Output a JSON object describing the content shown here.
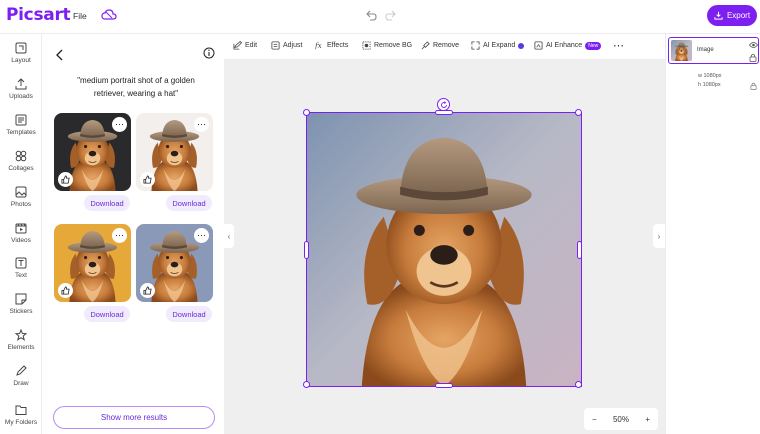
{
  "app": {
    "logo_text": "Picsart",
    "brand_color": "#7e1ff2",
    "file_menu": "File",
    "export_label": "Export"
  },
  "rail": {
    "items": [
      {
        "label": "Layout",
        "icon": "layout-icon"
      },
      {
        "label": "Uploads",
        "icon": "upload-icon"
      },
      {
        "label": "Templates",
        "icon": "templates-icon"
      },
      {
        "label": "Collages",
        "icon": "collages-icon"
      },
      {
        "label": "Photos",
        "icon": "photos-icon"
      },
      {
        "label": "Videos",
        "icon": "videos-icon"
      },
      {
        "label": "Text",
        "icon": "text-icon"
      },
      {
        "label": "Stickers",
        "icon": "stickers-icon"
      },
      {
        "label": "Elements",
        "icon": "elements-icon"
      },
      {
        "label": "Draw",
        "icon": "draw-icon"
      },
      {
        "label": "My Folders",
        "icon": "folder-icon"
      }
    ]
  },
  "panel": {
    "prompt": "\"medium portrait shot of a golden retriever, wearing a hat\"",
    "results": [
      {
        "download_label": "Download"
      },
      {
        "download_label": "Download"
      },
      {
        "download_label": "Download"
      },
      {
        "download_label": "Download"
      }
    ],
    "more_icon": "⋯",
    "show_more_label": "Show more results"
  },
  "toolbar": {
    "tools": [
      {
        "label": "Edit",
        "icon": "edit-icon"
      },
      {
        "label": "Adjust",
        "icon": "adjust-icon"
      },
      {
        "label": "Effects",
        "icon": "effects-icon"
      },
      {
        "label": "Remove BG",
        "icon": "remove-bg-icon"
      },
      {
        "label": "Remove",
        "icon": "remove-icon"
      },
      {
        "label": "AI Expand",
        "icon": "ai-expand-icon"
      },
      {
        "label": "AI Enhance",
        "icon": "ai-enhance-icon",
        "badge": "New"
      }
    ],
    "more_label": "⋯"
  },
  "canvas": {
    "zoom_minus": "−",
    "zoom_value": "50%",
    "zoom_plus": "+",
    "collapse_left": "‹",
    "collapse_right": "›"
  },
  "layers": {
    "layer_name": "Image",
    "width_text": "w 1080px",
    "height_text": "h 1080px"
  }
}
